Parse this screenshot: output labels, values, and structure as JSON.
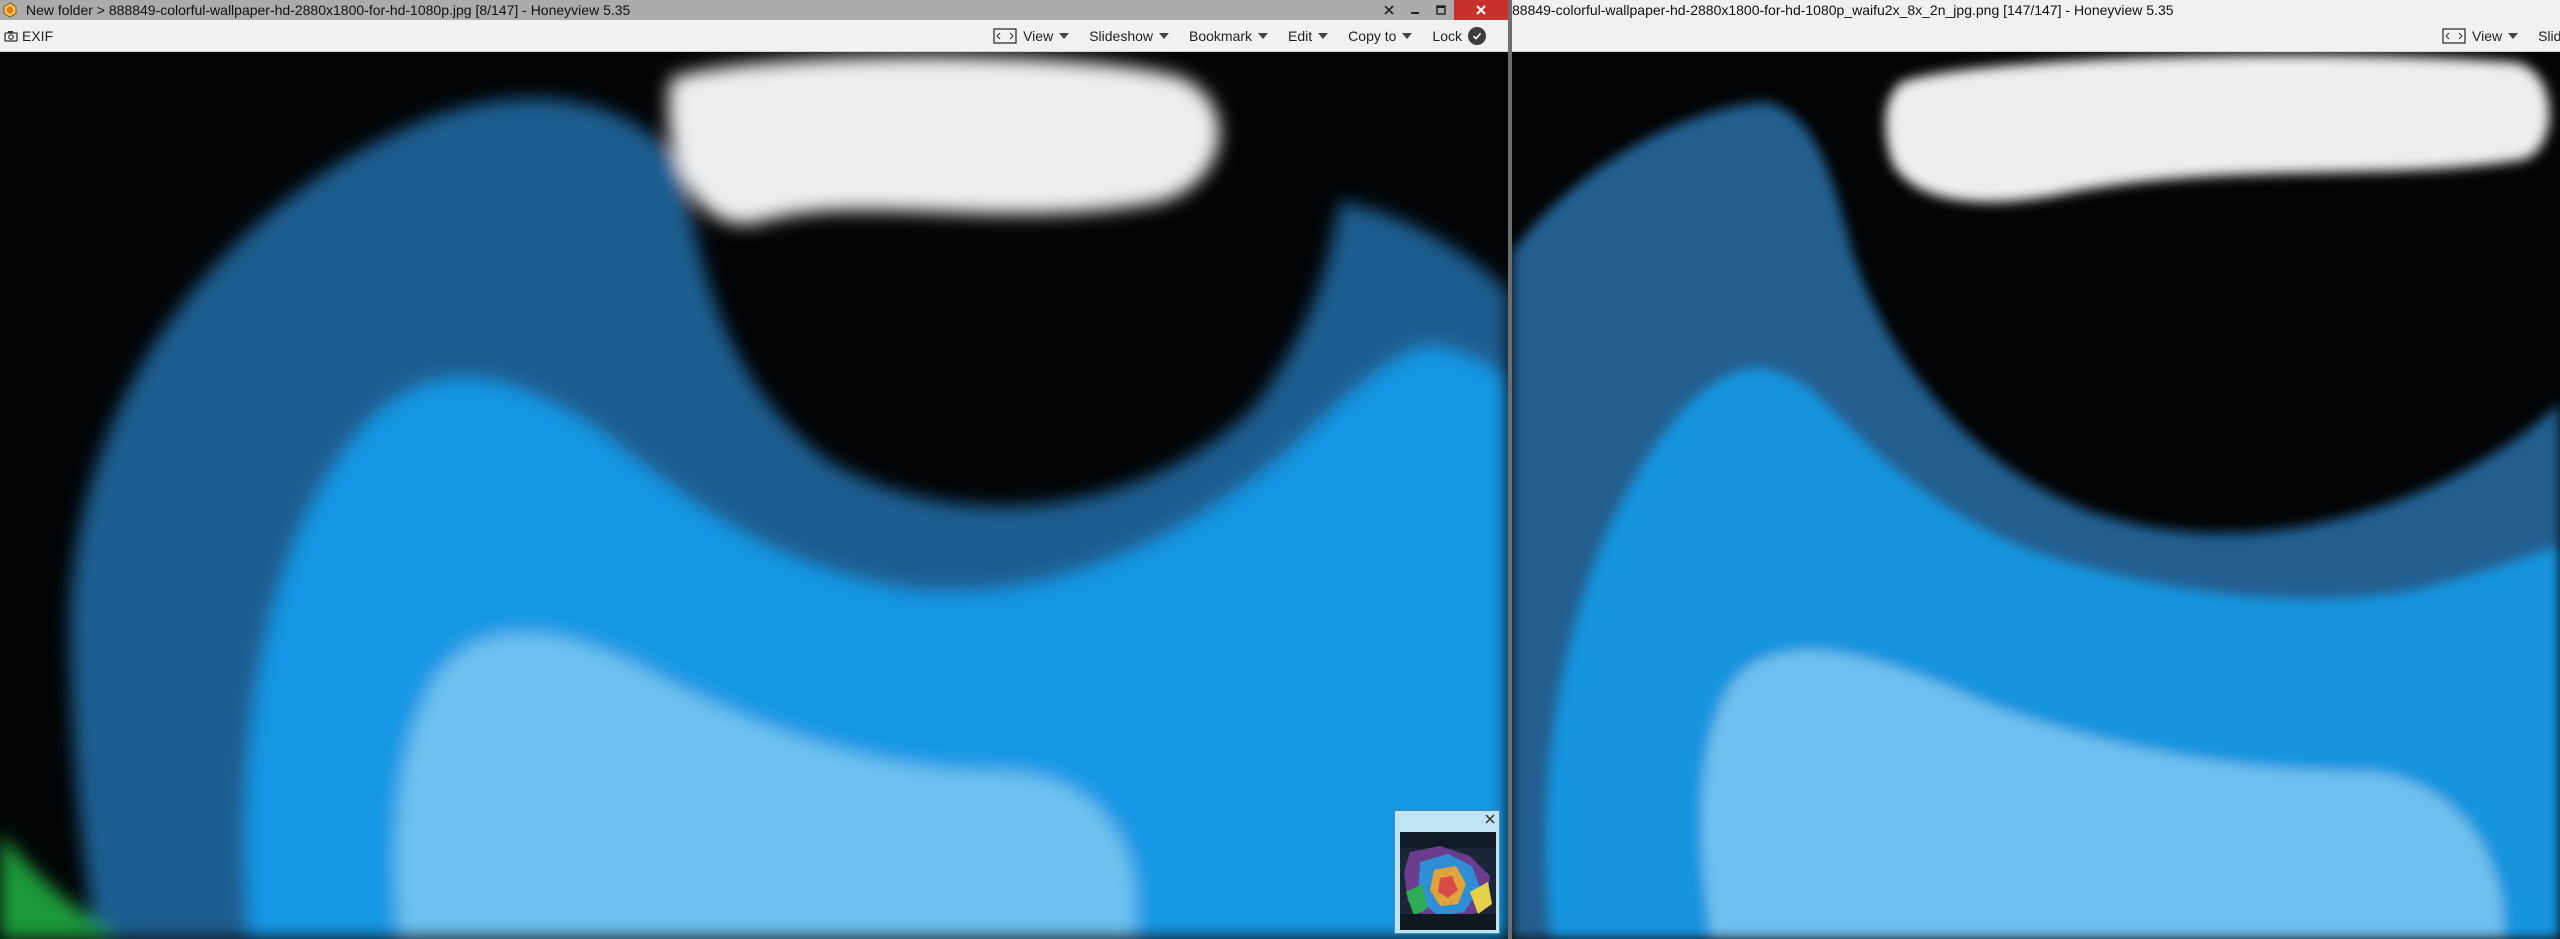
{
  "left_window": {
    "title": "New folder > 888849-colorful-wallpaper-hd-2880x1800-for-hd-1080p.jpg [8/147] - Honeyview 5.35",
    "toolbar": {
      "exif_label": "EXIF",
      "view_label": "View",
      "slideshow_label": "Slideshow",
      "bookmark_label": "Bookmark",
      "edit_label": "Edit",
      "copy_to_label": "Copy to",
      "lock_label": "Lock"
    }
  },
  "right_window": {
    "title": "88849-colorful-wallpaper-hd-2880x1800-for-hd-1080p_waifu2x_8x_2n_jpg.png [147/147] - Honeyview 5.35",
    "toolbar": {
      "view_label": "View",
      "slideshow_label": "Slides"
    }
  },
  "colors": {
    "titlebar_inactive": "#ababab",
    "titlebar_active": "#f0f0f0",
    "close_button": "#c9302c",
    "toolbar": "#f1f1f1",
    "navigator_frame": "#bfe4f5"
  },
  "icons": {
    "app": "honeyview-app-icon",
    "exif": "camera-icon",
    "view": "view-frame-icon",
    "dropdown": "caret-down-icon",
    "lock": "check-circle-icon",
    "close": "close-icon",
    "minimize": "minimize-icon",
    "maximize": "maximize-icon"
  }
}
